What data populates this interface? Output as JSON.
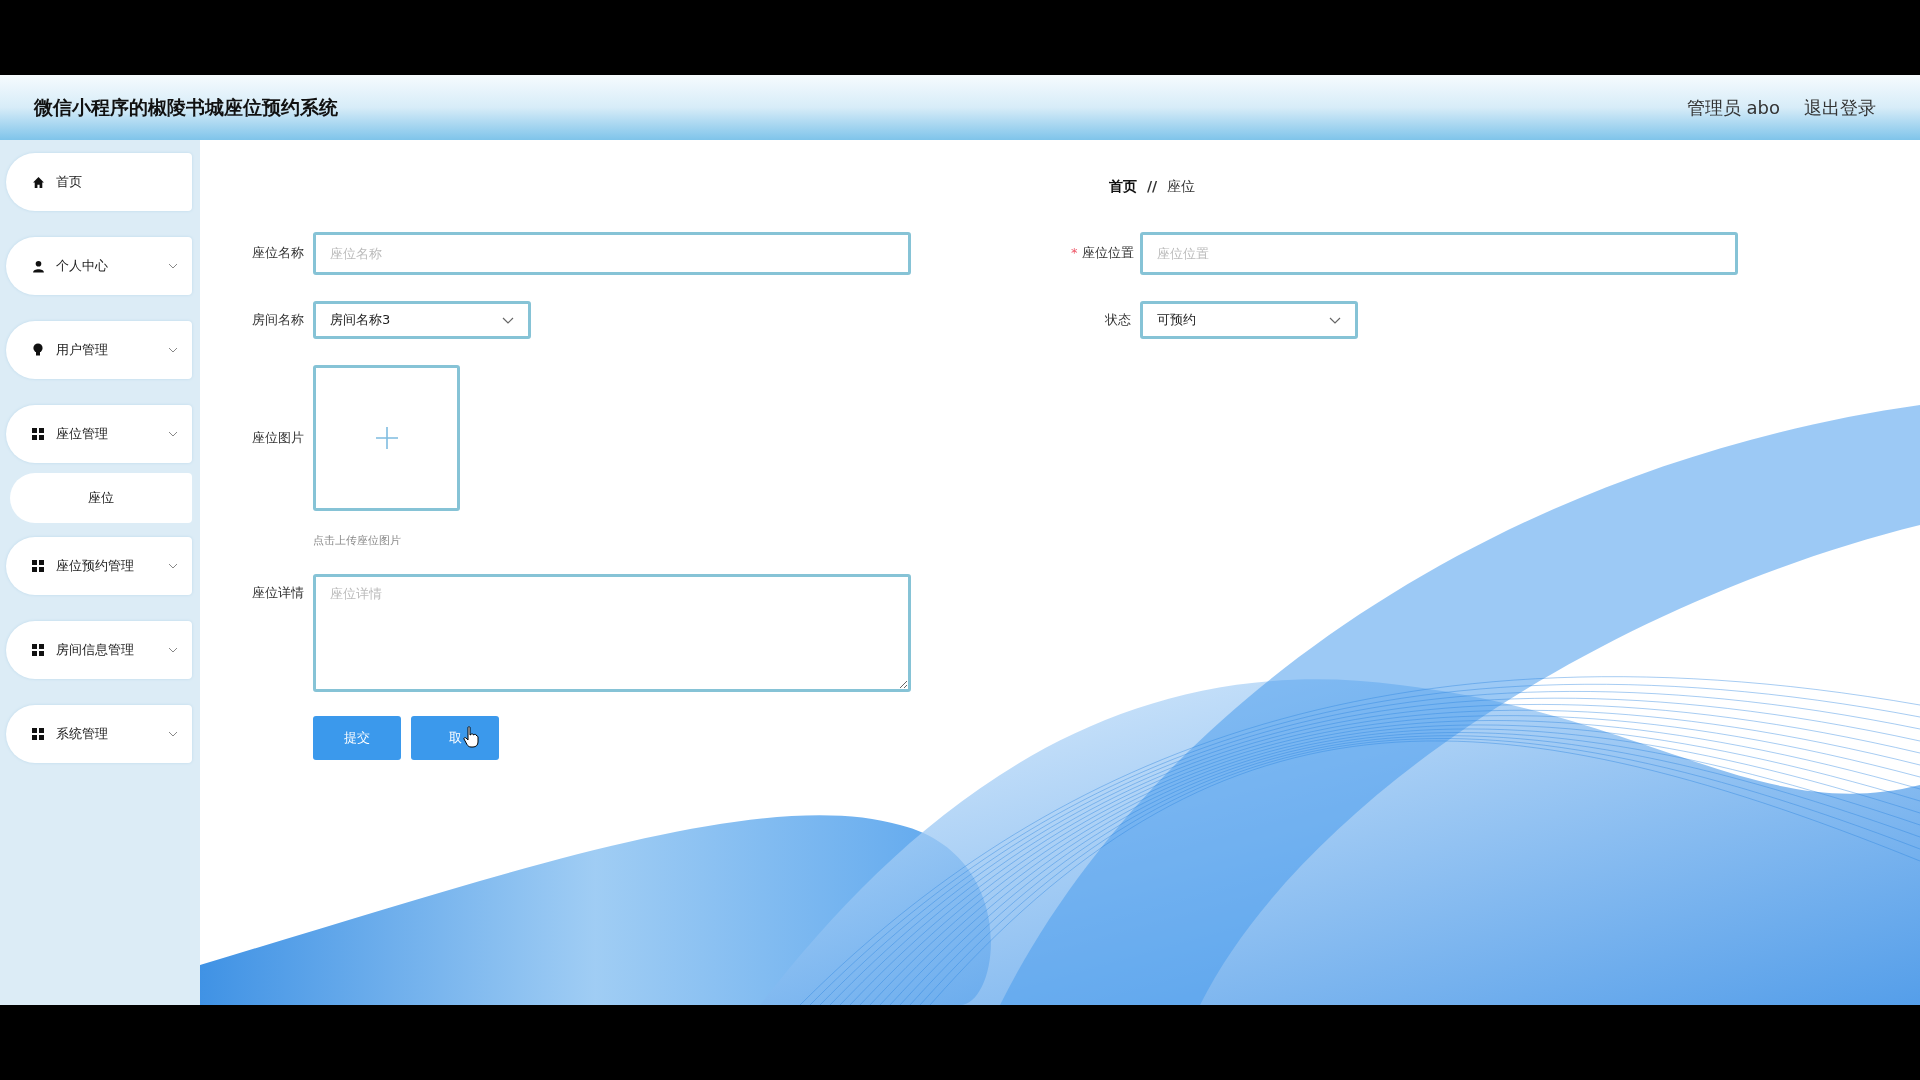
{
  "header": {
    "title": "微信小程序的椒陵书城座位预约系统",
    "user": "管理员 abo",
    "logout": "退出登录"
  },
  "sidebar": {
    "items": [
      {
        "label": "首页",
        "kind": "link"
      },
      {
        "label": "个人中心",
        "kind": "menu"
      },
      {
        "label": "用户管理",
        "kind": "menu"
      },
      {
        "label": "座位管理",
        "kind": "menu",
        "children": [
          {
            "label": "座位"
          }
        ]
      },
      {
        "label": "座位预约管理",
        "kind": "menu"
      },
      {
        "label": "房间信息管理",
        "kind": "menu"
      },
      {
        "label": "系统管理",
        "kind": "menu"
      }
    ]
  },
  "breadcrumb": {
    "items": [
      "首页",
      "座位"
    ],
    "separator": "//"
  },
  "form": {
    "rows": [
      [
        {
          "label": "座位名称",
          "kind": "text",
          "placeholder": "座位名称"
        },
        {
          "label": "座位位置",
          "kind": "text",
          "placeholder": "座位位置",
          "required_mark": "*"
        }
      ],
      [
        {
          "label": "房间名称",
          "kind": "select",
          "value": "房间名称3"
        },
        {
          "label": "状态",
          "kind": "select",
          "value": "可预约"
        }
      ],
      [
        {
          "label": "座位图片",
          "kind": "upload",
          "hint": "点击上传座位图片"
        }
      ],
      [
        {
          "label": "座位详情",
          "kind": "textarea",
          "placeholder": "座位详情"
        }
      ]
    ],
    "buttons": [
      "提交",
      "取"
    ]
  }
}
